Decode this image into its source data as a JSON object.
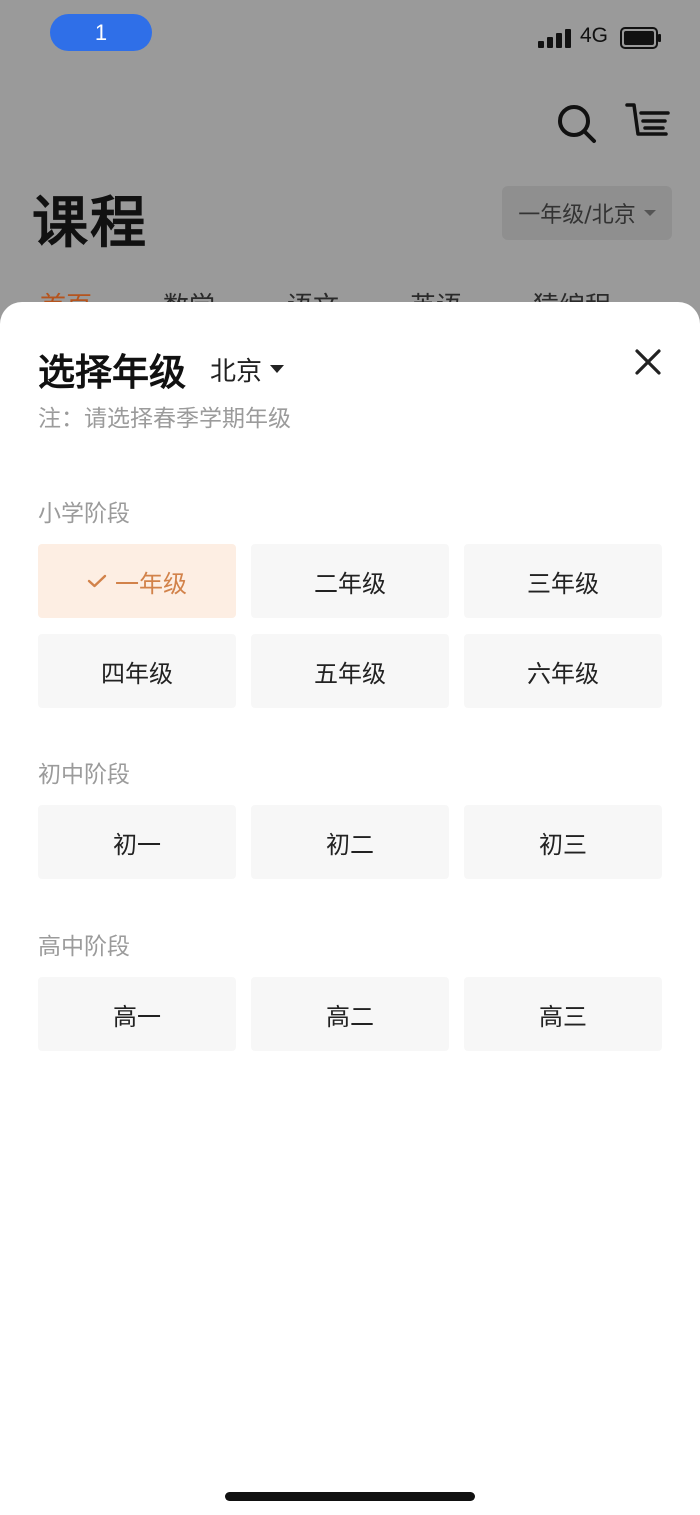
{
  "status_bar": {
    "time": "1",
    "network": "4G"
  },
  "background_page": {
    "title": "课程",
    "grade_city_selector": "一年级/北京",
    "tabs": [
      {
        "label": "首页",
        "active": true
      },
      {
        "label": "数学",
        "active": false
      },
      {
        "label": "语文",
        "active": false
      },
      {
        "label": "英语",
        "active": false
      },
      {
        "label": "猿编程",
        "active": false
      }
    ],
    "icons": [
      "search-icon",
      "cart-icon"
    ]
  },
  "sheet": {
    "title": "选择年级",
    "city": "北京",
    "note": "注：请选择春季学期年级",
    "sections": [
      {
        "label": "小学阶段",
        "grades": [
          {
            "label": "一年级",
            "selected": true
          },
          {
            "label": "二年级",
            "selected": false
          },
          {
            "label": "三年级",
            "selected": false
          },
          {
            "label": "四年级",
            "selected": false
          },
          {
            "label": "五年级",
            "selected": false
          },
          {
            "label": "六年级",
            "selected": false
          }
        ]
      },
      {
        "label": "初中阶段",
        "grades": [
          {
            "label": "初一",
            "selected": false
          },
          {
            "label": "初二",
            "selected": false
          },
          {
            "label": "初三",
            "selected": false
          }
        ]
      },
      {
        "label": "高中阶段",
        "grades": [
          {
            "label": "高一",
            "selected": false
          },
          {
            "label": "高二",
            "selected": false
          },
          {
            "label": "高三",
            "selected": false
          }
        ]
      }
    ]
  },
  "colors": {
    "accent": "#d2824a",
    "selected_bg": "#fdeee3",
    "overlay": "#9a9a9a",
    "muted_text": "#9b9b9b"
  }
}
